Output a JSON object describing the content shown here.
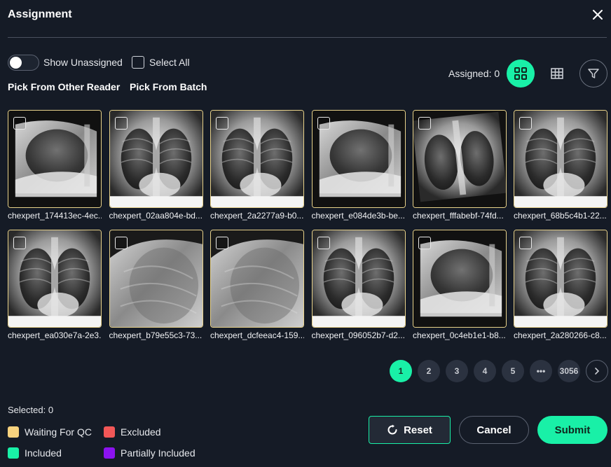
{
  "header": {
    "title": "Assignment"
  },
  "toolbar": {
    "show_unassigned_label": "Show Unassigned",
    "select_all_label": "Select All",
    "pick_other_reader_label": "Pick From Other Reader",
    "pick_batch_label": "Pick From Batch",
    "assigned_text": "Assigned: 0"
  },
  "items": [
    {
      "caption": "chexpert_174413ec-4ec...",
      "view": "lateral"
    },
    {
      "caption": "chexpert_02aa804e-bd...",
      "view": "frontal"
    },
    {
      "caption": "chexpert_2a2277a9-b0...",
      "view": "frontal"
    },
    {
      "caption": "chexpert_e084de3b-be...",
      "view": "lateral"
    },
    {
      "caption": "chexpert_fffabebf-74fd...",
      "view": "rotated"
    },
    {
      "caption": "chexpert_68b5c4b1-22...",
      "view": "frontal"
    },
    {
      "caption": "chexpert_ea030e7a-2e3...",
      "view": "frontal"
    },
    {
      "caption": "chexpert_b79e55c3-73...",
      "view": "closeup"
    },
    {
      "caption": "chexpert_dcfeeac4-159...",
      "view": "closeup"
    },
    {
      "caption": "chexpert_096052b7-d2...",
      "view": "frontal"
    },
    {
      "caption": "chexpert_0c4eb1e1-b8...",
      "view": "lateral"
    },
    {
      "caption": "chexpert_2a280266-c8...",
      "view": "frontal"
    }
  ],
  "pagination": {
    "pages": [
      "1",
      "2",
      "3",
      "4",
      "5",
      "•••",
      "3056"
    ],
    "active": "1"
  },
  "footer": {
    "selected_text": "Selected:  0",
    "legend": [
      {
        "label": "Waiting For QC",
        "color": "#f7d27e"
      },
      {
        "label": "Excluded",
        "color": "#f25757"
      },
      {
        "label": "Included",
        "color": "#19f0a7"
      },
      {
        "label": "Partially Included",
        "color": "#8b12ef"
      }
    ],
    "reset_label": "Reset",
    "cancel_label": "Cancel",
    "submit_label": "Submit"
  },
  "colors": {
    "accent": "#19f0a7",
    "background": "#151b26",
    "thumb_border": "#e8d28a"
  },
  "icons": {
    "close": "close-icon",
    "grid_view": "grid-view-icon",
    "table_view": "table-view-icon",
    "filter": "filter-icon",
    "reset": "refresh-icon",
    "next": "chevron-right-icon"
  }
}
